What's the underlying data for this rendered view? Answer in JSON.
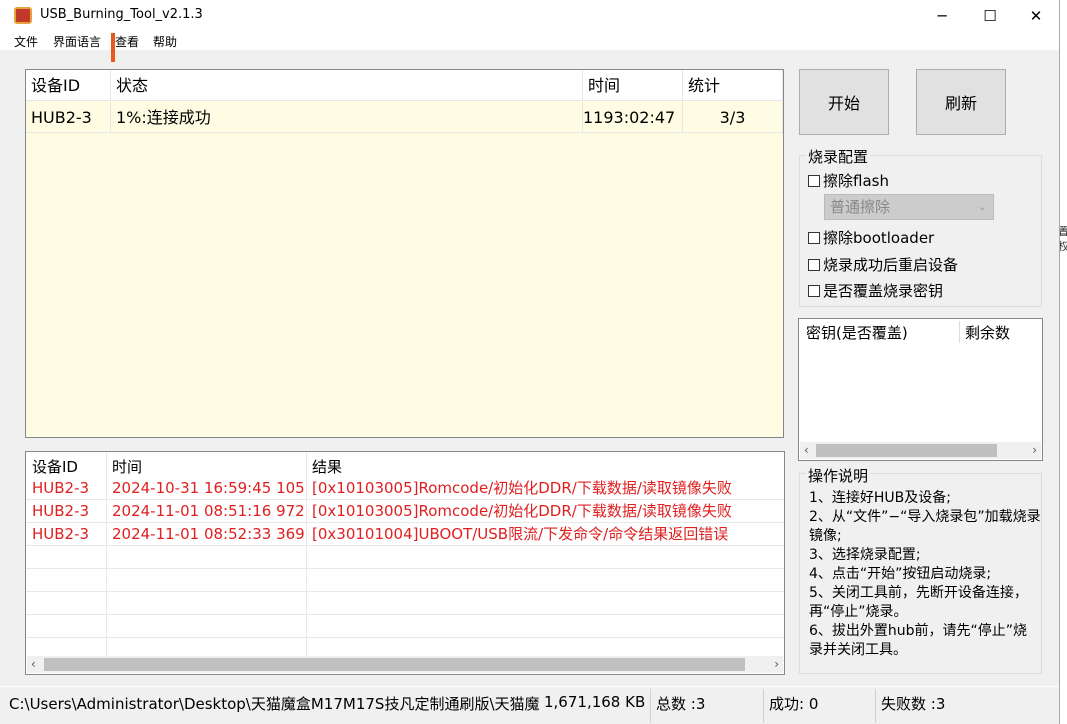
{
  "window": {
    "title": "USB_Burning_Tool_v2.1.3",
    "icon": "app-icon",
    "minimize": "─",
    "maximize": "☐",
    "close": "✕"
  },
  "menu": [
    "文件",
    "界面语言",
    "查看",
    "帮助"
  ],
  "device_table": {
    "headers": [
      "设备ID",
      "状态",
      "时间",
      "统计"
    ],
    "rows": [
      {
        "id": "HUB2-3",
        "status": "1%:连接成功",
        "time": "1193:02:47",
        "stats": "3/3"
      }
    ]
  },
  "buttons": {
    "start": "开始",
    "refresh": "刷新"
  },
  "config": {
    "legend": "烧录配置",
    "erase_flash": "擦除flash",
    "erase_mode": "普通擦除",
    "erase_bootloader": "擦除bootloader",
    "reboot_after": "烧录成功后重启设备",
    "overwrite_key": "是否覆盖烧录密钥"
  },
  "key_list": {
    "headers": [
      "密钥(是否覆盖)",
      "剩余数"
    ]
  },
  "help": {
    "legend": "操作说明",
    "text": "1、连接好HUB及设备;\n2、从“文件”−“导入烧录包”加载烧录镜像;\n3、选择烧录配置;\n4、点击“开始”按钮启动烧录;\n5、关闭工具前，先断开设备连接，再“停止”烧录。\n6、拔出外置hub前，请先“停止”烧录并关闭工具。"
  },
  "log_table": {
    "headers": [
      "设备ID",
      "时间",
      "结果"
    ],
    "rows": [
      {
        "id": "HUB2-3",
        "time": "2024-10-31 16:59:45 105",
        "result": "[0x10103005]Romcode/初始化DDR/下载数据/读取镜像失败"
      },
      {
        "id": "HUB2-3",
        "time": "2024-11-01 08:51:16 972",
        "result": "[0x10103005]Romcode/初始化DDR/下载数据/读取镜像失败"
      },
      {
        "id": "HUB2-3",
        "time": "2024-11-01 08:52:33 369",
        "result": "[0x30101004]UBOOT/USB限流/下发命令/命令结果返回错误"
      }
    ]
  },
  "status_bar": {
    "path": "C:\\Users\\Administrator\\Desktop\\天猫魔盒M17M17S技凡定制通刷版\\天猫魔",
    "size": "1,671,168 KB",
    "total": "总数 :3",
    "success": "成功:  0",
    "fail": "失败数 :3"
  },
  "colors": {
    "error_text": "#e02020",
    "progress": "#e8591a",
    "table_bg": "#fefde3"
  }
}
